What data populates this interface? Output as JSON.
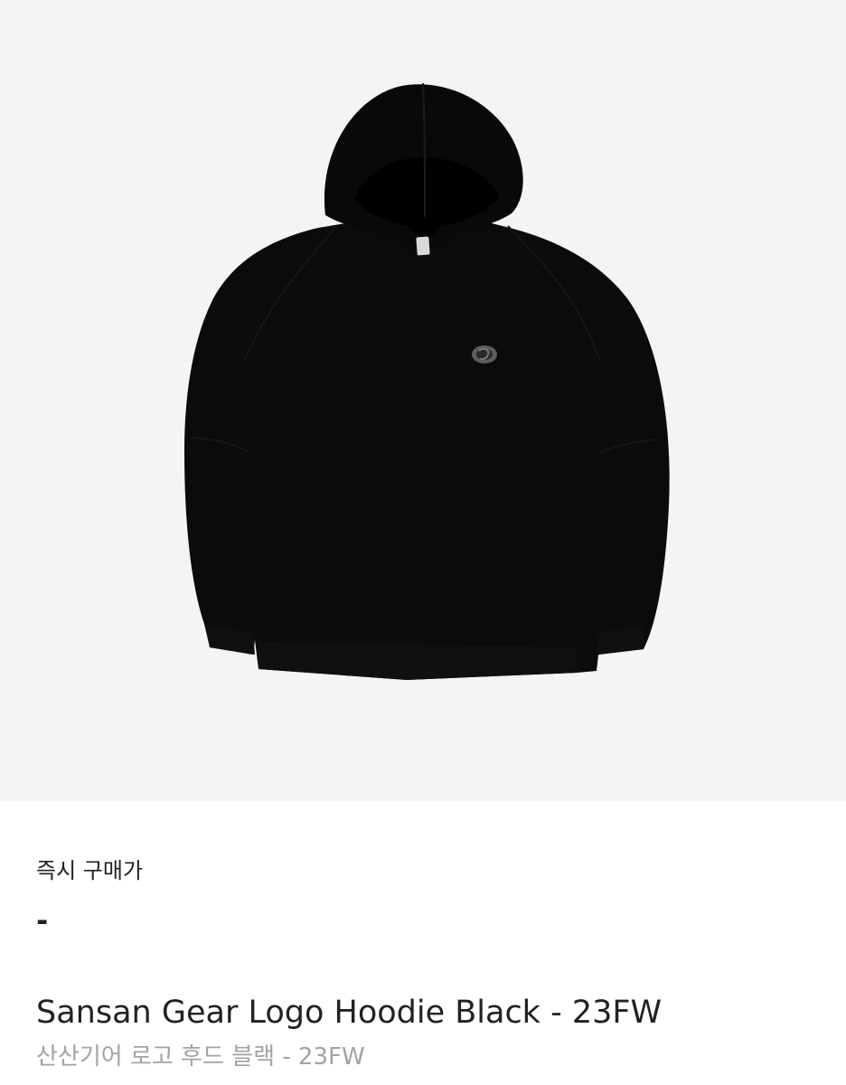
{
  "product": {
    "image_alt": "hoodie",
    "logo": "SS",
    "price_label": "즉시 구매가",
    "price_value": "-",
    "name_en": "Sansan Gear Logo Hoodie Black - 23FW",
    "name_ko": "산산기어 로고 후드 블랙 - 23FW"
  },
  "colors": {
    "image_background": "#f4f4f4",
    "garment": "#0b0b0b",
    "text_primary": "#222222",
    "text_secondary": "#a3a3a3"
  }
}
